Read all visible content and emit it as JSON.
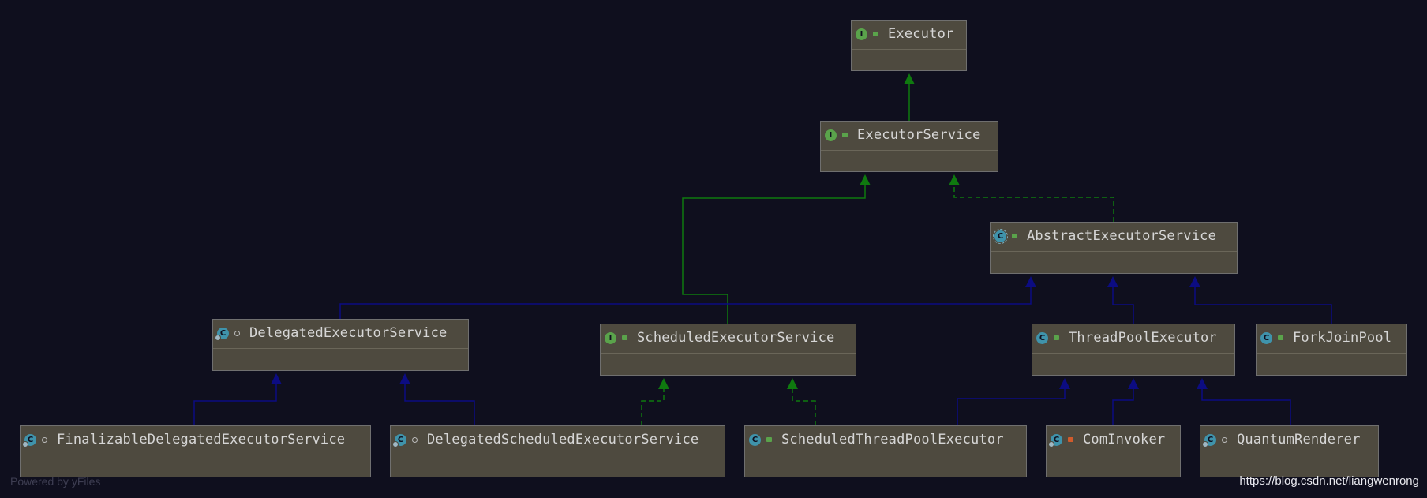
{
  "diagram": {
    "nodes": [
      {
        "id": "executor",
        "name": "Executor",
        "kind": "interface",
        "visibility": "public"
      },
      {
        "id": "executor-service",
        "name": "ExecutorService",
        "kind": "interface",
        "visibility": "public"
      },
      {
        "id": "abstract-executor-service",
        "name": "AbstractExecutorService",
        "kind": "abstract-class",
        "visibility": "public"
      },
      {
        "id": "delegated-executor-service",
        "name": "DelegatedExecutorService",
        "kind": "class",
        "visibility": "package",
        "final": true
      },
      {
        "id": "scheduled-executor-service",
        "name": "ScheduledExecutorService",
        "kind": "interface",
        "visibility": "public"
      },
      {
        "id": "thread-pool-executor",
        "name": "ThreadPoolExecutor",
        "kind": "class",
        "visibility": "public"
      },
      {
        "id": "fork-join-pool",
        "name": "ForkJoinPool",
        "kind": "class",
        "visibility": "public"
      },
      {
        "id": "finalizable-delegated-executor-service",
        "name": "FinalizableDelegatedExecutorService",
        "kind": "class",
        "visibility": "package",
        "final": true
      },
      {
        "id": "delegated-scheduled-executor-service",
        "name": "DelegatedScheduledExecutorService",
        "kind": "class",
        "visibility": "package",
        "final": true
      },
      {
        "id": "scheduled-thread-pool-executor",
        "name": "ScheduledThreadPoolExecutor",
        "kind": "class",
        "visibility": "public"
      },
      {
        "id": "com-invoker",
        "name": "ComInvoker",
        "kind": "class",
        "visibility": "private",
        "final": true
      },
      {
        "id": "quantum-renderer",
        "name": "QuantumRenderer",
        "kind": "class",
        "visibility": "package",
        "final": true
      }
    ],
    "edges": [
      {
        "from": "executor-service",
        "to": "executor",
        "type": "extends"
      },
      {
        "from": "abstract-executor-service",
        "to": "executor-service",
        "type": "implements"
      },
      {
        "from": "scheduled-executor-service",
        "to": "executor-service",
        "type": "extends"
      },
      {
        "from": "delegated-executor-service",
        "to": "abstract-executor-service",
        "type": "class-extends"
      },
      {
        "from": "thread-pool-executor",
        "to": "abstract-executor-service",
        "type": "class-extends"
      },
      {
        "from": "fork-join-pool",
        "to": "abstract-executor-service",
        "type": "class-extends"
      },
      {
        "from": "finalizable-delegated-executor-service",
        "to": "delegated-executor-service",
        "type": "class-extends"
      },
      {
        "from": "delegated-scheduled-executor-service",
        "to": "delegated-executor-service",
        "type": "class-extends"
      },
      {
        "from": "delegated-scheduled-executor-service",
        "to": "scheduled-executor-service",
        "type": "implements"
      },
      {
        "from": "scheduled-thread-pool-executor",
        "to": "scheduled-executor-service",
        "type": "implements"
      },
      {
        "from": "scheduled-thread-pool-executor",
        "to": "thread-pool-executor",
        "type": "class-extends"
      },
      {
        "from": "com-invoker",
        "to": "thread-pool-executor",
        "type": "class-extends"
      },
      {
        "from": "quantum-renderer",
        "to": "thread-pool-executor",
        "type": "class-extends"
      }
    ],
    "kind_letters": {
      "interface": "I",
      "class": "C",
      "abstract-class": "C"
    },
    "colors": {
      "background": "#0f0f1e",
      "node_fill": "#4e4a3f",
      "node_border": "#6f6f6f",
      "interface_edge": "#0f7a0f",
      "class_edge": "#0c0c82",
      "interface_icon": "#5aa34b",
      "class_icon": "#3f93ab",
      "private_icon": "#d05b2c"
    }
  },
  "footer": {
    "left": "Powered by yFiles",
    "right": "https://blog.csdn.net/liangwenrong"
  }
}
